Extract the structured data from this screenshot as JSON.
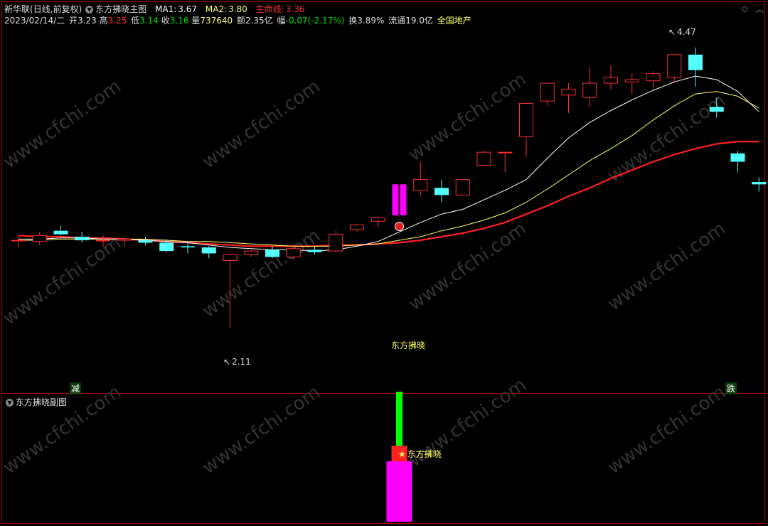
{
  "header": {
    "stock_name": "新华联",
    "period": "(日线,前复权)",
    "indicator_name": "东方拂晓主图",
    "ma1_label": "MA1:",
    "ma1_value": "3.67",
    "ma2_label": "MA2:",
    "ma2_value": "3.80",
    "life_label": "生命线:",
    "life_value": "3.36"
  },
  "quote": {
    "date": "2023/02/14/二",
    "open_label": "开",
    "open": "3.23",
    "high_label": "高",
    "high": "3.25",
    "low_label": "低",
    "low": "3.14",
    "close_label": "收",
    "close": "3.16",
    "vol_label": "量",
    "vol": "737640",
    "amount_label": "额",
    "amount": "2.35亿",
    "change_label": "幅",
    "change": "-0.07(-2.17%)",
    "turnover_label": "换",
    "turnover": "3.89%",
    "float_label": "流通",
    "float": "19.0亿",
    "sector": "全国地产"
  },
  "annotations": {
    "max_price": "4.47",
    "min_price": "2.11",
    "signal_label": "东方拂晓",
    "sub_signal_label": "东方拂晓",
    "tag_left": "减",
    "tag_right": "跌"
  },
  "sub_panel": {
    "title": "东方拂晓副图"
  },
  "watermark": "www.cfchi.com",
  "colors": {
    "up": "#ff3030",
    "down": "#54ffff",
    "ma1": "#ffffff",
    "ma2": "#ffff66",
    "life": "#ff2020",
    "signal": "#ff00ff",
    "sub_green": "#00ff00",
    "frame": "#b00000"
  },
  "chart_data": {
    "type": "candlestick",
    "price_range": [
      1.62,
      4.63
    ],
    "candles": [
      {
        "o": 2.85,
        "h": 2.89,
        "l": 2.79,
        "c": 2.85
      },
      {
        "o": 2.84,
        "h": 2.92,
        "l": 2.81,
        "c": 2.89
      },
      {
        "o": 2.93,
        "h": 2.97,
        "l": 2.89,
        "c": 2.9
      },
      {
        "o": 2.88,
        "h": 2.92,
        "l": 2.83,
        "c": 2.85
      },
      {
        "o": 2.85,
        "h": 2.89,
        "l": 2.8,
        "c": 2.85
      },
      {
        "o": 2.85,
        "h": 2.88,
        "l": 2.8,
        "c": 2.86
      },
      {
        "o": 2.85,
        "h": 2.88,
        "l": 2.81,
        "c": 2.83
      },
      {
        "o": 2.83,
        "h": 2.86,
        "l": 2.75,
        "c": 2.76
      },
      {
        "o": 2.8,
        "h": 2.83,
        "l": 2.74,
        "c": 2.79
      },
      {
        "o": 2.79,
        "h": 2.8,
        "l": 2.7,
        "c": 2.74
      },
      {
        "o": 2.68,
        "h": 2.74,
        "l": 2.11,
        "c": 2.73
      },
      {
        "o": 2.73,
        "h": 2.77,
        "l": 2.71,
        "c": 2.76
      },
      {
        "o": 2.77,
        "h": 2.8,
        "l": 2.7,
        "c": 2.71
      },
      {
        "o": 2.71,
        "h": 2.82,
        "l": 2.69,
        "c": 2.78
      },
      {
        "o": 2.77,
        "h": 2.8,
        "l": 2.73,
        "c": 2.75
      },
      {
        "o": 2.76,
        "h": 2.93,
        "l": 2.75,
        "c": 2.9
      },
      {
        "o": 2.94,
        "h": 2.99,
        "l": 2.92,
        "c": 2.98
      },
      {
        "o": 3.01,
        "h": 3.05,
        "l": 2.96,
        "c": 3.04
      },
      {
        "o": 3.06,
        "h": 3.32,
        "l": 3.05,
        "c": 3.32
      },
      {
        "o": 3.27,
        "h": 3.51,
        "l": 3.22,
        "c": 3.36
      },
      {
        "o": 3.29,
        "h": 3.36,
        "l": 3.17,
        "c": 3.23
      },
      {
        "o": 3.23,
        "h": 3.36,
        "l": 3.23,
        "c": 3.36
      },
      {
        "o": 3.48,
        "h": 3.6,
        "l": 3.47,
        "c": 3.59
      },
      {
        "o": 3.59,
        "h": 3.59,
        "l": 3.42,
        "c": 3.59
      },
      {
        "o": 3.72,
        "h": 4.0,
        "l": 3.55,
        "c": 4.0
      },
      {
        "o": 4.02,
        "h": 4.17,
        "l": 3.98,
        "c": 4.17
      },
      {
        "o": 4.07,
        "h": 4.17,
        "l": 3.92,
        "c": 4.12
      },
      {
        "o": 4.05,
        "h": 4.3,
        "l": 3.97,
        "c": 4.17
      },
      {
        "o": 4.17,
        "h": 4.32,
        "l": 4.12,
        "c": 4.22
      },
      {
        "o": 4.18,
        "h": 4.25,
        "l": 4.08,
        "c": 4.2
      },
      {
        "o": 4.19,
        "h": 4.27,
        "l": 4.12,
        "c": 4.25
      },
      {
        "o": 4.22,
        "h": 4.38,
        "l": 4.17,
        "c": 4.41
      },
      {
        "o": 4.41,
        "h": 4.47,
        "l": 4.14,
        "c": 4.28
      },
      {
        "o": 3.97,
        "h": 4.05,
        "l": 3.88,
        "c": 3.93
      },
      {
        "o": 3.58,
        "h": 3.6,
        "l": 3.42,
        "c": 3.51
      },
      {
        "o": 3.34,
        "h": 3.38,
        "l": 3.26,
        "c": 3.32
      }
    ],
    "ma1": [
      2.86,
      2.86,
      2.87,
      2.87,
      2.86,
      2.86,
      2.85,
      2.84,
      2.83,
      2.81,
      2.79,
      2.78,
      2.77,
      2.77,
      2.76,
      2.77,
      2.8,
      2.84,
      2.92,
      3.0,
      3.07,
      3.11,
      3.19,
      3.27,
      3.36,
      3.54,
      3.71,
      3.84,
      3.94,
      4.03,
      4.11,
      4.18,
      4.23,
      4.2,
      4.1,
      3.93
    ],
    "ma2": [
      2.85,
      2.85,
      2.86,
      2.86,
      2.86,
      2.86,
      2.86,
      2.85,
      2.84,
      2.84,
      2.83,
      2.82,
      2.81,
      2.8,
      2.8,
      2.8,
      2.81,
      2.82,
      2.85,
      2.88,
      2.93,
      2.97,
      3.02,
      3.08,
      3.17,
      3.28,
      3.4,
      3.52,
      3.62,
      3.73,
      3.86,
      3.98,
      4.08,
      4.1,
      4.06,
      3.96
    ],
    "life": [
      2.89,
      2.88,
      2.88,
      2.87,
      2.87,
      2.86,
      2.85,
      2.84,
      2.83,
      2.82,
      2.81,
      2.8,
      2.8,
      2.8,
      2.8,
      2.81,
      2.81,
      2.82,
      2.83,
      2.85,
      2.88,
      2.91,
      2.95,
      3.0,
      3.07,
      3.14,
      3.22,
      3.29,
      3.37,
      3.44,
      3.51,
      3.57,
      3.62,
      3.66,
      3.68,
      3.68
    ],
    "signal_index": 18,
    "sub_bars": [
      {
        "index": 18,
        "segment": "base",
        "value": 85,
        "color": "#ff00ff"
      },
      {
        "index": 18,
        "segment": "red",
        "value": 22,
        "color": "#ff2020"
      },
      {
        "index": 18,
        "segment": "green",
        "value": 76,
        "color": "#00ff00"
      }
    ]
  }
}
